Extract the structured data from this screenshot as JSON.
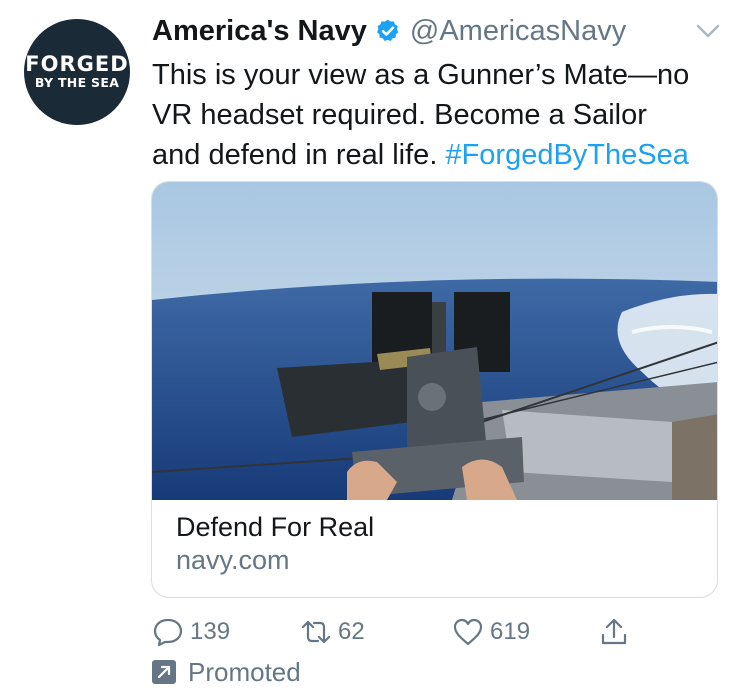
{
  "account": {
    "avatar_line1": "FORGED",
    "avatar_line2": "BY THE SEA",
    "display_name": "America's Navy",
    "handle": "@AmericasNavy",
    "verified": true
  },
  "tweet": {
    "text_line1": "This is your view as a Gunner’s Mate—no",
    "text_line2": "VR headset required. Become a Sailor",
    "text_line3": "and defend in real life. ",
    "hashtag": "#ForgedByTheSea"
  },
  "card": {
    "title": "Defend For Real",
    "domain": "navy.com"
  },
  "actions": {
    "replies": "139",
    "retweets": "62",
    "likes": "619"
  },
  "promoted_label": "Promoted",
  "colors": {
    "accent": "#1da1f2",
    "muted": "#657786",
    "avatar_bg": "#1b2a37"
  }
}
